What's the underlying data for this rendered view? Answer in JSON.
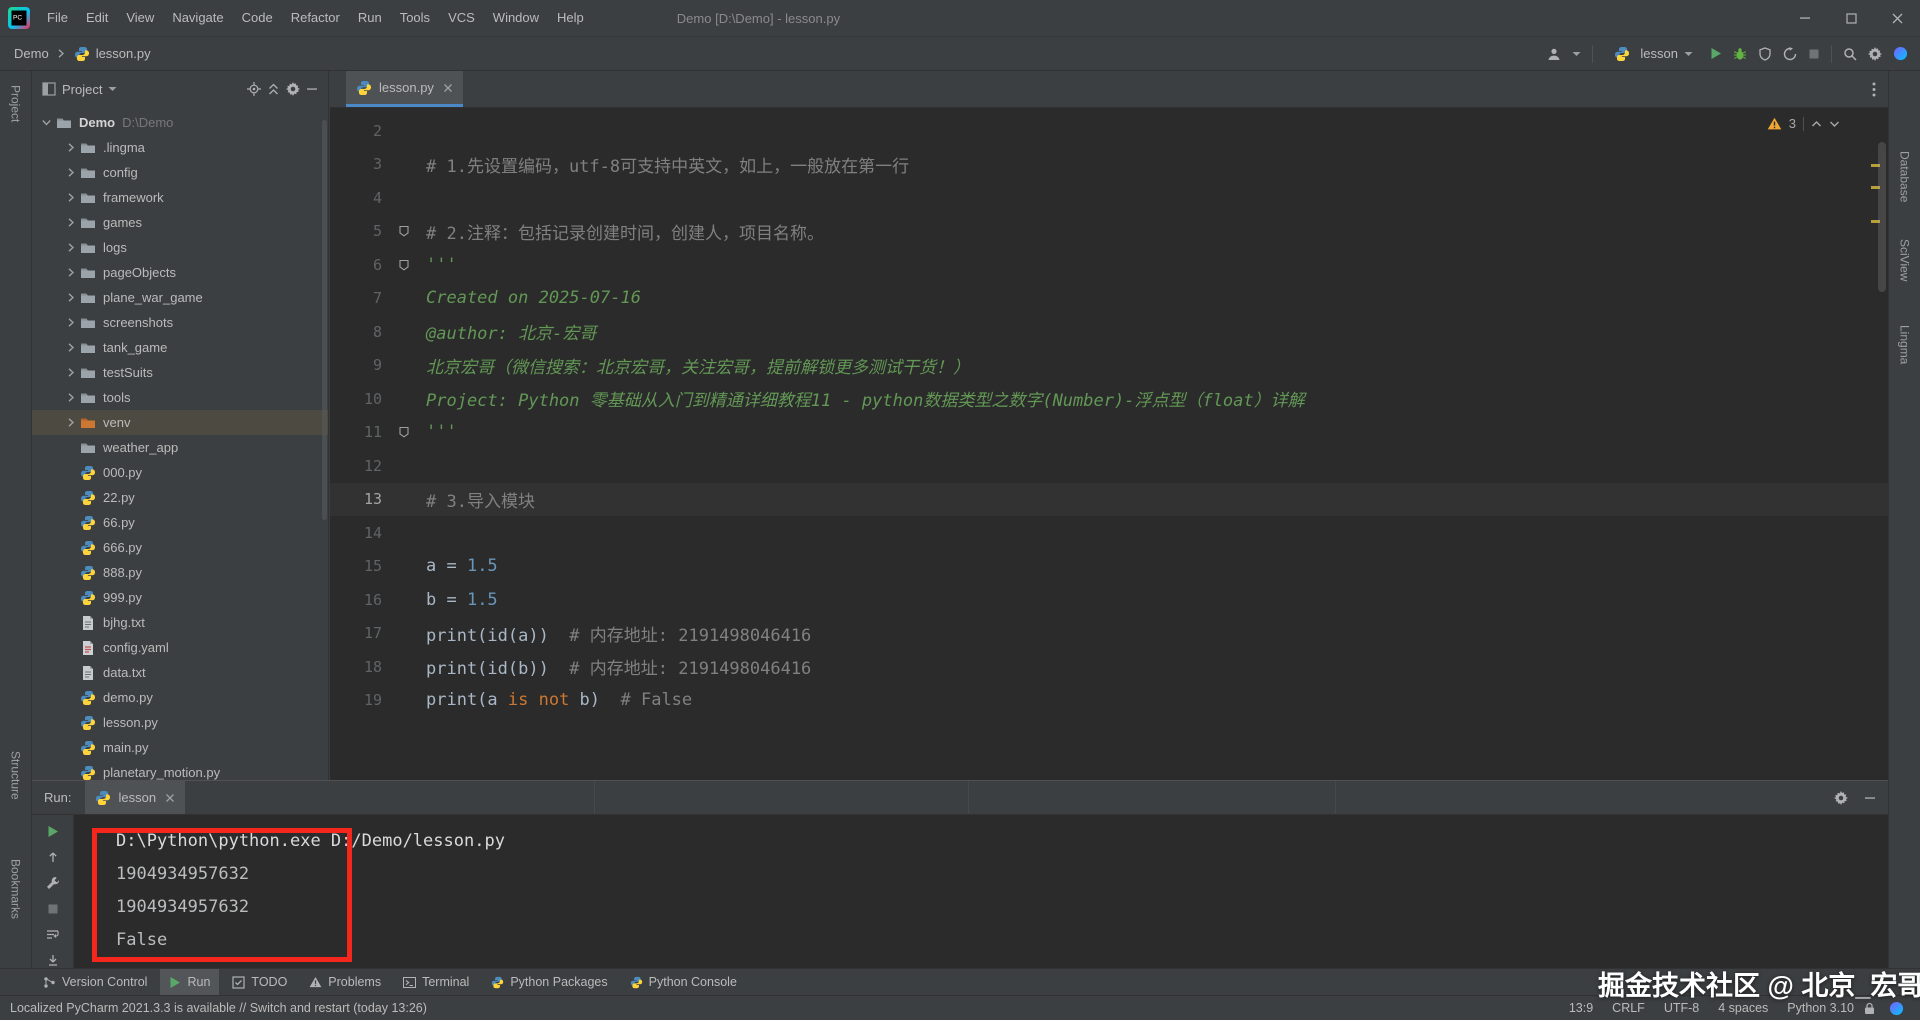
{
  "window": {
    "title": "Demo [D:\\Demo] - lesson.py",
    "menus": [
      "File",
      "Edit",
      "View",
      "Navigate",
      "Code",
      "Refactor",
      "Run",
      "Tools",
      "VCS",
      "Window",
      "Help"
    ]
  },
  "navbar": {
    "breadcrumb_project": "Demo",
    "breadcrumb_file": "lesson.py",
    "run_config": "lesson"
  },
  "left_stripe": [
    "Project",
    "Structure",
    "Bookmarks"
  ],
  "right_stripe": [
    "Database",
    "SciView",
    "Lingma"
  ],
  "project": {
    "header": "Project",
    "tree": [
      {
        "label": "Demo",
        "path": "D:\\Demo",
        "type": "folder",
        "depth": 0,
        "chevron": "down",
        "bold": true
      },
      {
        "label": ".lingma",
        "type": "folder",
        "depth": 1,
        "chevron": "right"
      },
      {
        "label": "config",
        "type": "folder",
        "depth": 1,
        "chevron": "right"
      },
      {
        "label": "framework",
        "type": "folder",
        "depth": 1,
        "chevron": "right"
      },
      {
        "label": "games",
        "type": "folder",
        "depth": 1,
        "chevron": "right"
      },
      {
        "label": "logs",
        "type": "folder",
        "depth": 1,
        "chevron": "right"
      },
      {
        "label": "pageObjects",
        "type": "folder",
        "depth": 1,
        "chevron": "right"
      },
      {
        "label": "plane_war_game",
        "type": "folder",
        "depth": 1,
        "chevron": "right"
      },
      {
        "label": "screenshots",
        "type": "folder",
        "depth": 1,
        "chevron": "right"
      },
      {
        "label": "tank_game",
        "type": "folder",
        "depth": 1,
        "chevron": "right"
      },
      {
        "label": "testSuits",
        "type": "folder",
        "depth": 1,
        "chevron": "right"
      },
      {
        "label": "tools",
        "type": "folder",
        "depth": 1,
        "chevron": "right"
      },
      {
        "label": "venv",
        "type": "folder-venv",
        "depth": 1,
        "chevron": "right",
        "selected": true
      },
      {
        "label": "weather_app",
        "type": "folder",
        "depth": 1,
        "chevron": "none"
      },
      {
        "label": "000.py",
        "type": "py",
        "depth": 1,
        "chevron": "none"
      },
      {
        "label": "22.py",
        "type": "py",
        "depth": 1,
        "chevron": "none"
      },
      {
        "label": "66.py",
        "type": "py",
        "depth": 1,
        "chevron": "none"
      },
      {
        "label": "666.py",
        "type": "py",
        "depth": 1,
        "chevron": "none"
      },
      {
        "label": "888.py",
        "type": "py",
        "depth": 1,
        "chevron": "none"
      },
      {
        "label": "999.py",
        "type": "py",
        "depth": 1,
        "chevron": "none"
      },
      {
        "label": "bjhg.txt",
        "type": "txt",
        "depth": 1,
        "chevron": "none"
      },
      {
        "label": "config.yaml",
        "type": "yaml",
        "depth": 1,
        "chevron": "none"
      },
      {
        "label": "data.txt",
        "type": "txt",
        "depth": 1,
        "chevron": "none"
      },
      {
        "label": "demo.py",
        "type": "py",
        "depth": 1,
        "chevron": "none"
      },
      {
        "label": "lesson.py",
        "type": "py",
        "depth": 1,
        "chevron": "none"
      },
      {
        "label": "main.py",
        "type": "py",
        "depth": 1,
        "chevron": "none"
      },
      {
        "label": "planetary_motion.py",
        "type": "py",
        "depth": 1,
        "chevron": "none"
      }
    ]
  },
  "editor": {
    "tab": "lesson.py",
    "warning_count": "3",
    "current_line": 13,
    "lines": [
      {
        "n": 2,
        "segs": []
      },
      {
        "n": 3,
        "segs": [
          [
            "# 1.先设置编码，utf-8可支持中英文，如上，一般放在第一行",
            "cm"
          ]
        ]
      },
      {
        "n": 4,
        "segs": []
      },
      {
        "n": 5,
        "segs": [
          [
            "# 2.注释：包括记录创建时间，创建人，项目名称。",
            "cm"
          ]
        ],
        "gicon": true
      },
      {
        "n": 6,
        "segs": [
          [
            "'''",
            "doc"
          ]
        ],
        "gicon": true
      },
      {
        "n": 7,
        "segs": [
          [
            "Created on 2025-07-16",
            "doc"
          ]
        ]
      },
      {
        "n": 8,
        "segs": [
          [
            "@author: 北京-宏哥",
            "doc"
          ]
        ]
      },
      {
        "n": 9,
        "segs": [
          [
            "北京宏哥（微信搜索：北京宏哥，关注宏哥，提前解锁更多测试干货！）",
            "doc"
          ]
        ]
      },
      {
        "n": 10,
        "segs": [
          [
            "Project: Python 零基础从入门到精通详细教程11 - python数据类型之数字(Number)-浮点型（float）详解",
            "doc"
          ]
        ]
      },
      {
        "n": 11,
        "segs": [
          [
            "'''",
            "doc"
          ]
        ],
        "gicon": true
      },
      {
        "n": 12,
        "segs": []
      },
      {
        "n": 13,
        "segs": [
          [
            "# 3.导入模块",
            "cm"
          ]
        ]
      },
      {
        "n": 14,
        "segs": []
      },
      {
        "n": 15,
        "segs": [
          [
            "a = ",
            "id"
          ],
          [
            "1.5",
            "num"
          ]
        ]
      },
      {
        "n": 16,
        "segs": [
          [
            "b = ",
            "id"
          ],
          [
            "1.5",
            "num"
          ]
        ]
      },
      {
        "n": 17,
        "segs": [
          [
            "print(id(a))",
            "id"
          ],
          [
            "  # 内存地址: 2191498046416",
            "cm"
          ]
        ]
      },
      {
        "n": 18,
        "segs": [
          [
            "print(id(b))",
            "id"
          ],
          [
            "  # 内存地址: 2191498046416",
            "cm"
          ]
        ]
      },
      {
        "n": 19,
        "segs": [
          [
            "print(a ",
            "id"
          ],
          [
            "is not",
            "kw"
          ],
          [
            " b)",
            "id"
          ],
          [
            "  # False",
            "cm"
          ]
        ]
      }
    ]
  },
  "run": {
    "label": "Run:",
    "tab": "lesson",
    "console": {
      "command": "D:\\Python\\python.exe D:/Demo/lesson.py",
      "outputs": [
        "1904934957632",
        "1904934957632",
        "False"
      ]
    }
  },
  "bottom_bar": [
    {
      "label": "Version Control",
      "icon": "vc"
    },
    {
      "label": "Run",
      "icon": "play_green",
      "active": true
    },
    {
      "label": "TODO",
      "icon": "todo"
    },
    {
      "label": "Problems",
      "icon": "warn_gray"
    },
    {
      "label": "Terminal",
      "icon": "terminal"
    },
    {
      "label": "Python Packages",
      "icon": "py"
    },
    {
      "label": "Python Console",
      "icon": "py"
    }
  ],
  "status_bar": {
    "message": "Localized PyCharm 2021.3.3 is available // Switch and restart (today 13:26)",
    "items": [
      "13:9",
      "CRLF",
      "UTF-8",
      "4 spaces",
      "Python 3.10"
    ]
  },
  "watermark": {
    "text": "掘金技术社区 @ 北京_宏哥"
  },
  "colors": {
    "panel_bg": "#3c3f41",
    "editor_bg": "#2b2b2b",
    "annotation_red": "#f5261b",
    "run_green": "#59A869",
    "warning_yellow": "#F0A732",
    "tab_underline_blue": "#4a88c7"
  }
}
